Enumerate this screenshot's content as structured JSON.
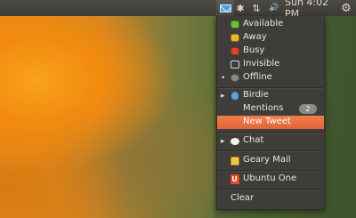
{
  "panel": {
    "clock": "Sun 4:02 PM",
    "indicators": [
      {
        "name": "messaging-indicator",
        "icon": "envelope-icon"
      },
      {
        "name": "bluetooth-indicator",
        "icon": "bluetooth-icon",
        "glyph": "✱"
      },
      {
        "name": "network-indicator",
        "icon": "network-arrows-icon",
        "glyph": "⇅"
      },
      {
        "name": "sound-indicator",
        "icon": "speaker-icon",
        "glyph": "🔊"
      },
      {
        "name": "session-indicator",
        "icon": "gear-power-icon",
        "glyph": "⚙"
      }
    ]
  },
  "menu": {
    "status": {
      "available": "Available",
      "away": "Away",
      "busy": "Busy",
      "invisible": "Invisible",
      "offline": "Offline",
      "selected": "Offline"
    },
    "birdie": {
      "label": "Birdie",
      "mentions_label": "Mentions",
      "mentions_count": "2",
      "new_tweet": "New Tweet"
    },
    "chat": "Chat",
    "geary": "Geary Mail",
    "ubuntu_one": "Ubuntu One",
    "clear": "Clear"
  },
  "colors": {
    "panel": "#3c3b37",
    "menu_bg": "#3e3d39",
    "highlight": "#e8703f",
    "messaging_icon": "#4aa3df"
  }
}
